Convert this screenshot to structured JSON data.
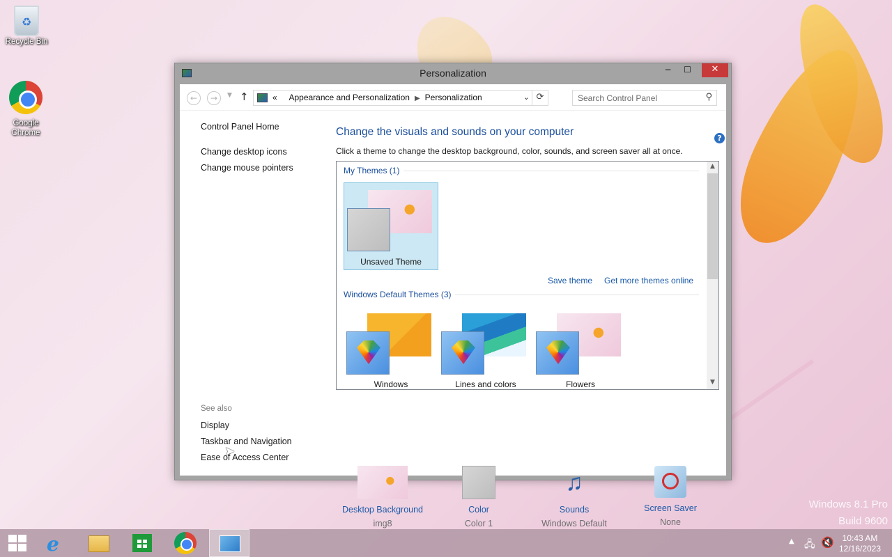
{
  "desktop": {
    "icons": [
      {
        "label": "Recycle Bin"
      },
      {
        "label": "Google Chrome"
      }
    ],
    "watermark": {
      "line1": "Windows 8.1 Pro",
      "line2": "Build 9600"
    }
  },
  "window": {
    "title": "Personalization",
    "controls": {
      "minimize": "−",
      "maximize": "☐",
      "close": "✕"
    },
    "breadcrumb": {
      "prefix": "«",
      "items": [
        "Appearance and Personalization",
        "Personalization"
      ]
    },
    "search": {
      "placeholder": "Search Control Panel"
    },
    "sidebar": {
      "home": "Control Panel Home",
      "links": [
        "Change desktop icons",
        "Change mouse pointers"
      ],
      "see_also_title": "See also",
      "see_also": [
        "Display",
        "Taskbar and Navigation",
        "Ease of Access Center"
      ]
    },
    "main": {
      "heading": "Change the visuals and sounds on your computer",
      "subtext": "Click a theme to change the desktop background, color, sounds, and screen saver all at once.",
      "my_themes_label": "My Themes (1)",
      "my_themes": [
        {
          "name": "Unsaved Theme",
          "selected": true
        }
      ],
      "save_theme": "Save theme",
      "get_more": "Get more themes online",
      "default_themes_label": "Windows Default Themes (3)",
      "default_themes": [
        {
          "name": "Windows"
        },
        {
          "name": "Lines and colors"
        },
        {
          "name": "Flowers"
        }
      ]
    },
    "bottom": [
      {
        "label": "Desktop Background",
        "value": "img8",
        "icon": "desktop-background-icon"
      },
      {
        "label": "Color",
        "value": "Color 1",
        "icon": "color-icon"
      },
      {
        "label": "Sounds",
        "value": "Windows Default",
        "icon": "sounds-icon"
      },
      {
        "label": "Screen Saver",
        "value": "None",
        "icon": "screen-saver-icon"
      }
    ]
  },
  "taskbar": {
    "items": [
      "start-icon",
      "internet-explorer-icon",
      "file-explorer-icon",
      "store-icon",
      "chrome-icon",
      "control-panel-icon"
    ],
    "clock": {
      "time": "10:43 AM",
      "date": "12/16/2023"
    }
  }
}
